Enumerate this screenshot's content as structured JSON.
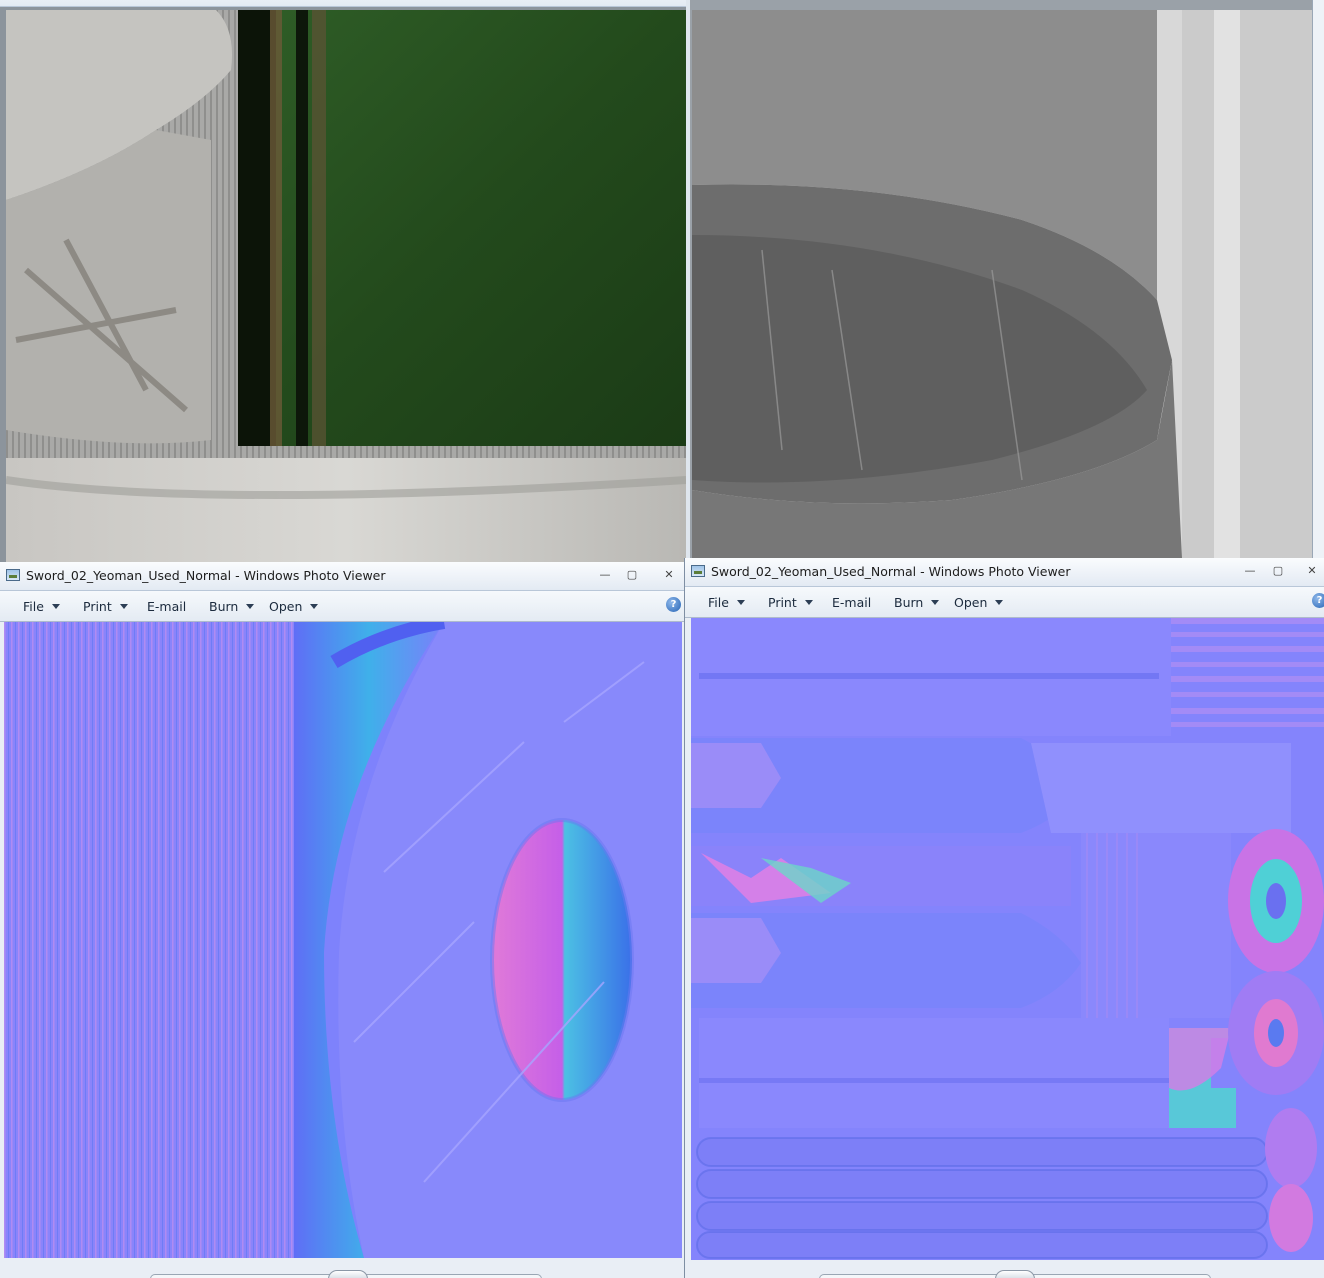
{
  "windows": [
    {
      "id": "top-left",
      "title": "",
      "content": "sword diffuse texture (grey metal with green grip)"
    },
    {
      "id": "top-right",
      "title": "",
      "content": "sword specular texture (grayscale)"
    },
    {
      "id": "bottom-left",
      "title": "Sword_02_Yeoman_Used_Normal - Windows Photo Viewer",
      "menu": {
        "file": "File",
        "print": "Print",
        "email": "E-mail",
        "burn": "Burn",
        "open": "Open"
      },
      "help": "?"
    },
    {
      "id": "bottom-right",
      "title": "Sword_02_Yeoman_Used_Normal - Windows Photo Viewer",
      "menu": {
        "file": "File",
        "print": "Print",
        "email": "E-mail",
        "burn": "Burn",
        "open": "Open"
      },
      "help": "?"
    }
  ],
  "caption_buttons": {
    "minimize": "—",
    "maximize": "▢",
    "close": "✕"
  },
  "colors": {
    "normal_map_base": "#8080ff",
    "grip_green": "#2c5a24",
    "metal_grey": "#a8a8a8",
    "titlebar": "#e9eef5"
  }
}
